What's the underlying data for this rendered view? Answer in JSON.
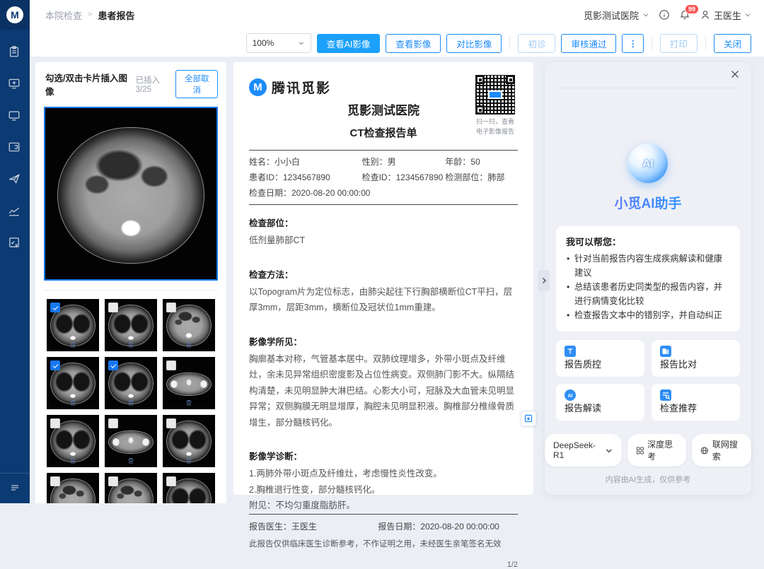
{
  "colors": {
    "primary_blue": "#1b9bfc",
    "sidebar_navy": "#0c3a72",
    "badge_red": "#fa5151",
    "checkbox_blue": "#1677f0"
  },
  "sidebar": {
    "logo_letter": "M",
    "items": [
      {
        "icon": "clipboard-icon"
      },
      {
        "icon": "monitor-plus-icon"
      },
      {
        "icon": "monitor-icon"
      },
      {
        "icon": "card-reader-icon"
      },
      {
        "icon": "send-icon"
      },
      {
        "icon": "chart-line-icon"
      },
      {
        "icon": "calculator-icon"
      }
    ],
    "footer_icon": "collapse-menu-icon"
  },
  "header": {
    "breadcrumb_parent": "本院检查",
    "breadcrumb_sep": ">",
    "breadcrumb_current": "患者报告",
    "hospital": "觅影测试医院",
    "badge_count": "99",
    "user": "王医生"
  },
  "toolbar": {
    "zoom": "100%",
    "buttons": [
      {
        "label": "查看AI影像",
        "style": "primary",
        "name": "view-ai-image-button"
      },
      {
        "label": "查看影像",
        "style": "outline",
        "name": "view-image-button"
      },
      {
        "label": "对比影像",
        "style": "outline",
        "name": "compare-image-button",
        "divider_after": true
      },
      {
        "label": "初诊",
        "style": "disabled",
        "name": "first-diagnosis-button"
      },
      {
        "label": "审核通过",
        "style": "outline",
        "name": "approve-button"
      },
      {
        "label": "⋮",
        "style": "dots",
        "name": "more-actions-button",
        "divider_after": true
      },
      {
        "label": "打印",
        "style": "disabled",
        "name": "print-button",
        "divider_after": true
      },
      {
        "label": "关闭",
        "style": "outline",
        "name": "close-button"
      }
    ]
  },
  "gallery": {
    "title": "勾选/双击卡片插入图像",
    "inserted_label": "已插入 3/25",
    "cancel_all_label": "全部取消",
    "thumbs": [
      {
        "checked": true,
        "variant": "chest1"
      },
      {
        "checked": false,
        "variant": "chest2"
      },
      {
        "checked": false,
        "variant": "abdomen1"
      },
      {
        "checked": true,
        "variant": "chest3"
      },
      {
        "checked": true,
        "variant": "chest4"
      },
      {
        "checked": false,
        "variant": "shoulder1"
      },
      {
        "checked": false,
        "variant": "chest5"
      },
      {
        "checked": false,
        "variant": "neck1"
      },
      {
        "checked": false,
        "variant": "chest6"
      },
      {
        "checked": false,
        "variant": "abdomen2"
      },
      {
        "checked": false,
        "variant": "abdomen3"
      },
      {
        "checked": false,
        "variant": "chest7"
      }
    ]
  },
  "report": {
    "brand": "腾讯觅影",
    "hospital_title": "觅影测试医院",
    "report_title": "CT检查报告单",
    "qr_caption_1": "扫一扫，查看",
    "qr_caption_2": "电子影像报告",
    "patient": {
      "name": "姓名：小小白",
      "gender": "性别：男",
      "age": "年龄：50",
      "patient_id": "患者ID：1234567890",
      "exam_id": "检查ID：1234567890",
      "body_part": "检测部位：肺部",
      "exam_date": "检查日期：2020-08-20 00:00:00"
    },
    "sections": [
      {
        "title": "检查部位：",
        "lines": [
          "低剂量肺部CT"
        ],
        "gap": "normal"
      },
      {
        "title": "检查方法：",
        "lines": [
          "以Topogram片为定位标志，由肺尖起往下行胸部横断位CT平扫，层厚3mm，层距3mm，横断位及冠状位1mm重建。"
        ],
        "gap": "large"
      },
      {
        "title": "影像学所见：",
        "lines": [
          "胸廓基本对称，气管基本居中。双肺纹理增多，外带小斑点及纤维灶，余未见异常组织密度影及占位性病变。双侧肺门影不大。纵隔结构清楚，未见明显肿大淋巴结。心影大小可，冠脉及大血管未见明显异常；双侧胸膜无明显增厚，胸腔未见明显积液。胸椎部分椎缘骨质增生，部分髓核钙化。"
        ],
        "gap": "large"
      },
      {
        "title": "影像学诊断：",
        "lines": [
          "1.两肺外带小斑点及纤维灶，考虑慢性炎性改变。",
          "2.胸椎退行性变，部分髓核钙化。",
          "附见：不均匀重度脂肪肝。"
        ],
        "gap": "large"
      }
    ],
    "footer": {
      "doctor": "报告医生：王医生",
      "date": "报告日期：2020-08-20 00:00:00",
      "disclaimer": "此报告仅供临床医生诊断参考，不作证明之用，未经医生亲笔签名无效",
      "page": "1/2"
    }
  },
  "ai_panel": {
    "title": "小觅AI助手",
    "sphere_label": "AI",
    "help_title": "我可以帮您：",
    "bullets": [
      "针对当前报告内容生成疾病解读和健康建议",
      "总结该患者历史同类型的报告内容，并进行病情变化比较",
      "检查报告文本中的错别字，并自动纠正"
    ],
    "actions": [
      {
        "label": "报告质控",
        "icon": "report-qc-icon"
      },
      {
        "label": "报告比对",
        "icon": "report-compare-icon"
      },
      {
        "label": "报告解读",
        "icon": "report-interpret-icon"
      },
      {
        "label": "检查推荐",
        "icon": "exam-recommend-icon"
      }
    ],
    "model_pill": "DeepSeek-R1",
    "deep_think": "深度思考",
    "web_search": "联网搜索",
    "footnote": "内容由AI生成，仅供参考"
  }
}
